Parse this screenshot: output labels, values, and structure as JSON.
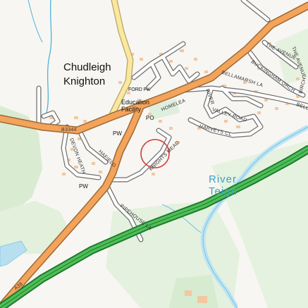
{
  "map": {
    "place_name": "Chudleigh Knighton",
    "facility_labels": [
      "FORD PK",
      "Education Facility"
    ],
    "road_labels": [
      "B3344",
      "HOMELEA",
      "RIVER",
      "VALLEY ROAD",
      "HARVEYS CL",
      "BELLAMARSH LA",
      "BUCKINGHAM ORCH",
      "THE AVENUE",
      "THE AVENUE",
      "BIRCH",
      "BELL",
      "DEVON HEATH",
      "HAFIELD",
      "KNIGHTS MEAD",
      "PIPEHOUSE LA",
      "A38"
    ],
    "symbols": [
      "PW",
      "PO",
      "PW"
    ],
    "water_label": "River Teign",
    "marker": "red-circle"
  }
}
